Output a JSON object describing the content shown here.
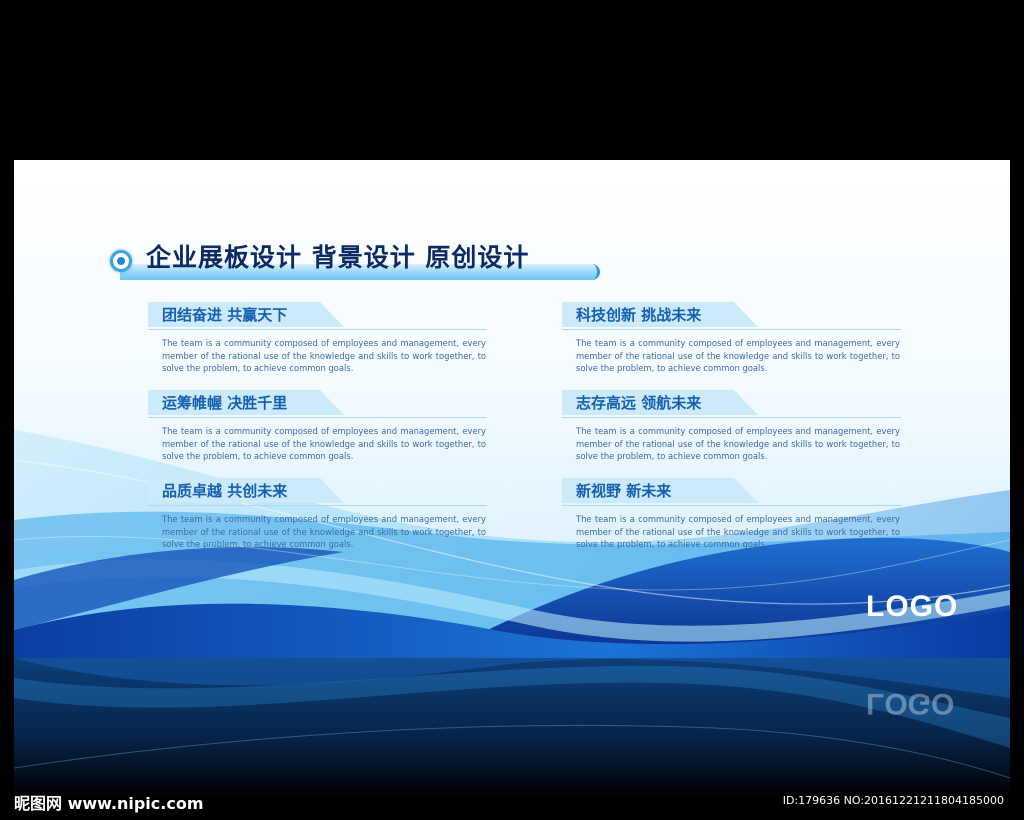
{
  "header": {
    "title": "企业展板设计 背景设计 原创设计"
  },
  "sections": [
    {
      "title": "团结奋进 共赢天下",
      "body": "The team is a community composed of employees and management, every member of the rational use of the knowledge and skills to work together, to solve the problem, to achieve common goals."
    },
    {
      "title": "科技创新 挑战未来",
      "body": "The team is a community composed of employees and management, every member of the rational use of the knowledge and skills to work together, to solve the problem, to achieve common goals."
    },
    {
      "title": "运筹帷幄 决胜千里",
      "body": "The team is a community composed of employees and management, every member of the rational use of the knowledge and skills to work together, to solve the problem, to achieve common goals."
    },
    {
      "title": "志存高远 领航未来",
      "body": "The team is a community composed of employees and management, every member of the rational use of the knowledge and skills to work together, to solve the problem, to achieve common goals."
    },
    {
      "title": "品质卓越 共创未来",
      "body": "The team is a community composed of employees and management, every member of the rational use of the knowledge and skills to work together, to solve the problem, to achieve common goals."
    },
    {
      "title": "新视野 新未来",
      "body": "The team is a community composed of employees and management, every member of the rational use of the knowledge and skills to work together, to solve the problem, to achieve common goals."
    }
  ],
  "logo": "LOGO",
  "watermark": {
    "left": "昵图网 www.nipic.com",
    "right": "ID:179636 NO:20161221211804185000"
  },
  "colors": {
    "title": "#0c2a66",
    "section_title": "#1560b0",
    "body_text": "#3b6ba3",
    "wave_dark": "#0a3fa8",
    "wave_light": "#5fc4f2"
  }
}
